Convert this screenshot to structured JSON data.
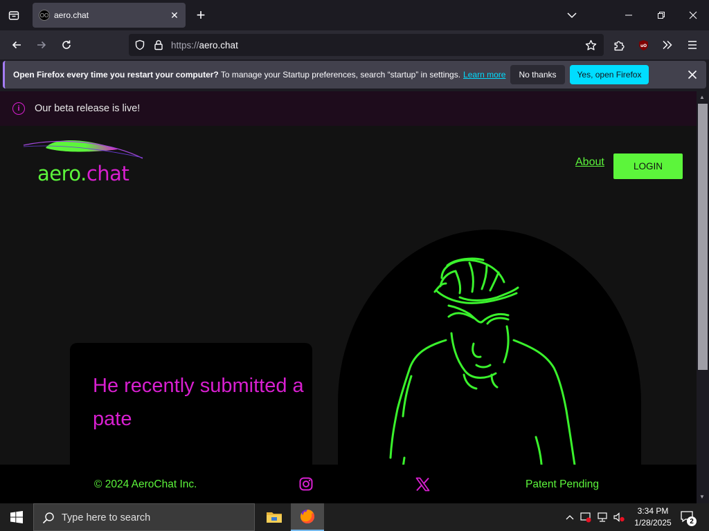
{
  "browser": {
    "tab": {
      "title": "aero.chat",
      "favicon_text": "OO"
    },
    "url": {
      "scheme": "https://",
      "host": "aero.chat"
    }
  },
  "notification": {
    "title": "Open Firefox every time you restart your computer?",
    "message": "To manage your Startup preferences, search “startup” in settings.",
    "link": "Learn more",
    "no_button": "No thanks",
    "yes_button": "Yes, open Firefox"
  },
  "page": {
    "beta_banner": "Our beta release is live!",
    "logo": {
      "aero": "aero",
      "dot": ".",
      "chat": "chat"
    },
    "nav": {
      "about": "About",
      "login": "LOGIN"
    },
    "card_text": "He recently submitted a pate",
    "footer": {
      "copyright": "© 2024 AeroChat Inc.",
      "patent": "Patent Pending"
    }
  },
  "taskbar": {
    "search_placeholder": "Type here to search",
    "time": "3:34 PM",
    "date": "1/28/2025",
    "notification_count": "2"
  },
  "colors": {
    "accent_green": "#5cf53b",
    "accent_magenta": "#d81fd0",
    "firefox_cyan": "#00ddff"
  }
}
